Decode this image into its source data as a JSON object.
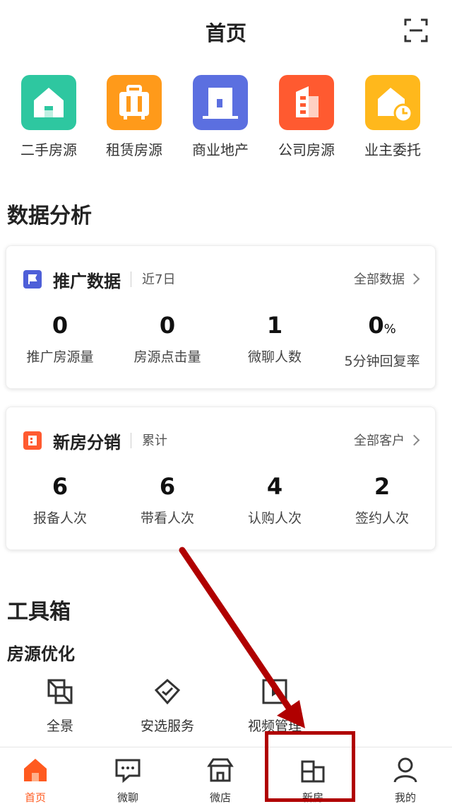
{
  "header": {
    "title": "首页"
  },
  "quick_access": [
    {
      "label": "二手房源",
      "icon": "house-icon",
      "color": "#2ec7a0"
    },
    {
      "label": "租赁房源",
      "icon": "suitcase-icon",
      "color": "#ff9a1a"
    },
    {
      "label": "商业地产",
      "icon": "office-building-icon",
      "color": "#5b6fe0"
    },
    {
      "label": "公司房源",
      "icon": "company-building-icon",
      "color": "#ff5a30"
    },
    {
      "label": "业主委托",
      "icon": "house-clock-icon",
      "color": "#ffb81c"
    }
  ],
  "data_section": {
    "title": "数据分析"
  },
  "promo_card": {
    "title": "推广数据",
    "period": "近7日",
    "more": "全部数据",
    "accent": "#4e5fd8",
    "stats": [
      {
        "value": "0",
        "unit": "",
        "label": "推广房源量"
      },
      {
        "value": "0",
        "unit": "",
        "label": "房源点击量"
      },
      {
        "value": "1",
        "unit": "",
        "label": "微聊人数"
      },
      {
        "value": "0",
        "unit": "%",
        "label": "5分钟回复率"
      }
    ]
  },
  "newhouse_card": {
    "title": "新房分销",
    "period": "累计",
    "more": "全部客户",
    "accent": "#ff5a30",
    "stats": [
      {
        "value": "6",
        "label": "报备人次"
      },
      {
        "value": "6",
        "label": "带看人次"
      },
      {
        "value": "4",
        "label": "认购人次"
      },
      {
        "value": "2",
        "label": "签约人次"
      }
    ]
  },
  "toolbox": {
    "title": "工具箱",
    "subtitle": "房源优化",
    "items": [
      {
        "label": "全景",
        "icon": "panorama-icon"
      },
      {
        "label": "安选服务",
        "icon": "house-shield-icon"
      },
      {
        "label": "视频管理",
        "icon": "video-icon"
      }
    ]
  },
  "tabbar": {
    "active_color": "#ff5a1f",
    "items": [
      {
        "label": "首页",
        "icon": "home-icon",
        "active": true
      },
      {
        "label": "微聊",
        "icon": "chat-icon",
        "active": false
      },
      {
        "label": "微店",
        "icon": "shop-icon",
        "active": false
      },
      {
        "label": "新房",
        "icon": "building-icon",
        "active": false
      },
      {
        "label": "我的",
        "icon": "user-icon",
        "active": false
      }
    ]
  },
  "annotation": {
    "color": "#b00000"
  }
}
